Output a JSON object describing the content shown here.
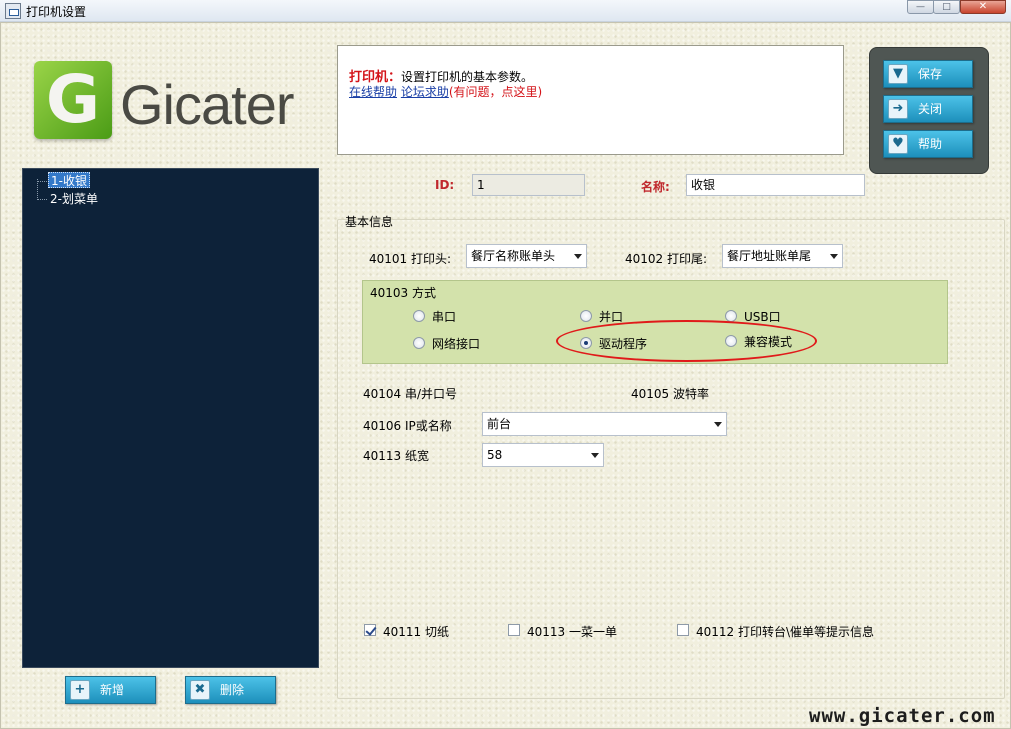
{
  "window": {
    "title": "打印机设置",
    "min_glyph": "—",
    "max_glyph": "□",
    "close_glyph": "✕"
  },
  "logo": {
    "letter": "G",
    "text": "Gicater"
  },
  "tree": {
    "items": [
      {
        "label": "1-收银",
        "selected": true
      },
      {
        "label": "2-划菜单",
        "selected": false
      }
    ]
  },
  "left_buttons": {
    "add_label": "新增",
    "delete_label": "删除"
  },
  "info": {
    "title_prefix": "打印机：",
    "title_desc": "设置打印机的基本参数。",
    "link_online_help": "在线帮助",
    "link_forum_help": "论坛求助",
    "note": "(有问题，点这里)"
  },
  "actions": {
    "save_label": "保存",
    "close_label": "关闭",
    "help_label": "帮助"
  },
  "record": {
    "id_label": "ID:",
    "id_value": "1",
    "name_label": "名称:",
    "name_value": "收银"
  },
  "basic": {
    "section_title": "基本信息",
    "header_label": "40101 打印头:",
    "header_value": "餐厅名称账单头",
    "footer_label": "40102 打印尾:",
    "footer_value": "餐厅地址账单尾"
  },
  "mode": {
    "title": "40103 方式",
    "options": [
      {
        "label": "串口",
        "checked": false
      },
      {
        "label": "并口",
        "checked": false
      },
      {
        "label": "USB口",
        "checked": false
      },
      {
        "label": "网络接口",
        "checked": false
      },
      {
        "label": "驱动程序",
        "checked": true
      },
      {
        "label": "兼容模式",
        "checked": false
      }
    ]
  },
  "port": {
    "port_label": "40104 串/并口号",
    "baud_label": "40105 波特率",
    "ip_label": "40106 IP或名称",
    "ip_value": "前台",
    "paper_label": "40113 纸宽",
    "paper_value": "58"
  },
  "checks": [
    {
      "label": "40111 切纸",
      "checked": true
    },
    {
      "label": "40113 一菜一单",
      "checked": false
    },
    {
      "label": "40112  打印转台\\催单等提示信息",
      "checked": false
    }
  ],
  "watermark": "www.gicater.com"
}
